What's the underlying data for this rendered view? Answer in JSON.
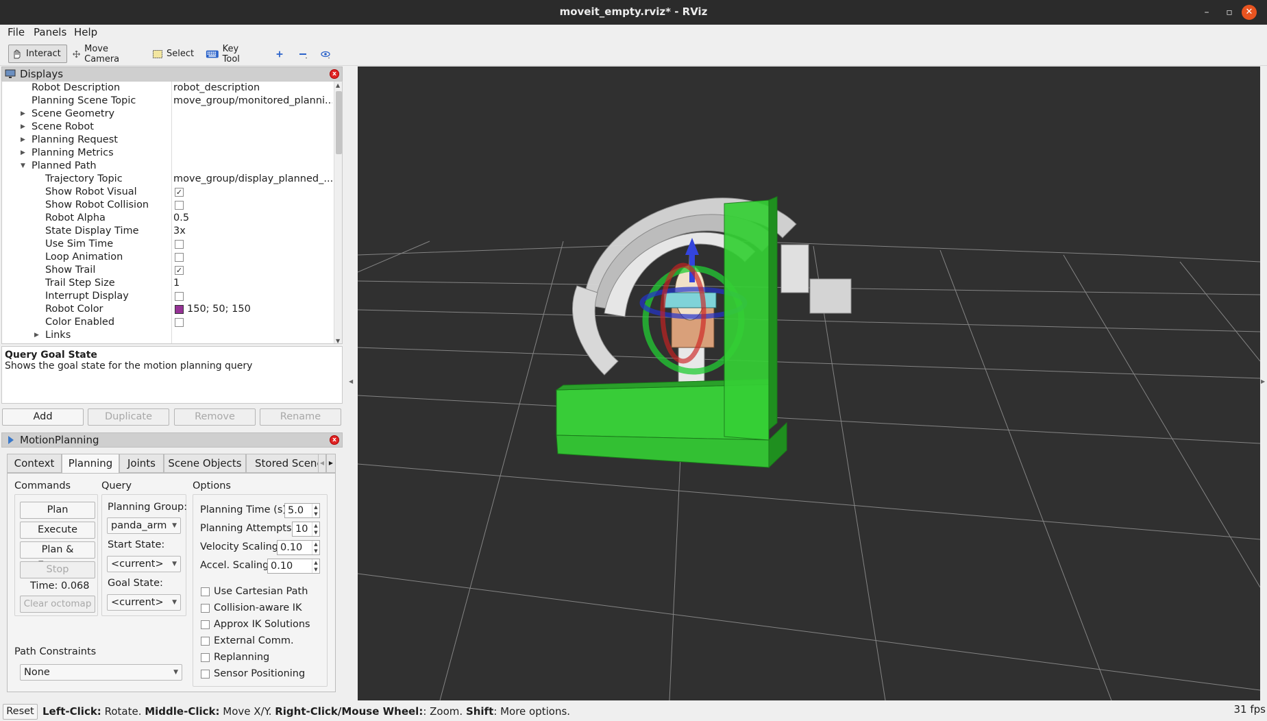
{
  "window": {
    "title": "moveit_empty.rviz* - RViz",
    "minimize_glyph": "–",
    "restore_glyph": "▫",
    "close_glyph": "✕"
  },
  "menu": [
    "File",
    "Panels",
    "Help"
  ],
  "toolbar": {
    "interact": "Interact",
    "move_camera": "Move Camera",
    "select": "Select",
    "key_tool": "Key Tool"
  },
  "displays": {
    "title": "Displays",
    "rows": [
      {
        "key": "Robot Description",
        "value": "robot_description"
      },
      {
        "key": "Planning Scene Topic",
        "value": "move_group/monitored_planni..."
      },
      {
        "key": "Scene Geometry",
        "value": ""
      },
      {
        "key": "Scene Robot",
        "value": ""
      },
      {
        "key": "Planning Request",
        "value": ""
      },
      {
        "key": "Planning Metrics",
        "value": ""
      },
      {
        "key": "Planned Path",
        "value": ""
      },
      {
        "key": "Trajectory Topic",
        "value": "move_group/display_planned_..."
      },
      {
        "key": "Show Robot Visual",
        "value": ""
      },
      {
        "key": "Show Robot Collision",
        "value": ""
      },
      {
        "key": "Robot Alpha",
        "value": "0.5"
      },
      {
        "key": "State Display Time",
        "value": "3x"
      },
      {
        "key": "Use Sim Time",
        "value": ""
      },
      {
        "key": "Loop Animation",
        "value": ""
      },
      {
        "key": "Show Trail",
        "value": ""
      },
      {
        "key": "Trail Step Size",
        "value": "1"
      },
      {
        "key": "Interrupt Display",
        "value": ""
      },
      {
        "key": "Robot Color",
        "value": "150; 50; 150"
      },
      {
        "key": "Color Enabled",
        "value": ""
      },
      {
        "key": "Links",
        "value": ""
      }
    ],
    "checks": {
      "show_robot_visual": true,
      "show_robot_collision": false,
      "use_sim_time": false,
      "loop_animation": false,
      "show_trail": true,
      "interrupt_display": false,
      "color_enabled": false
    },
    "robot_color_swatch": "#963296",
    "desc_title": "Query Goal State",
    "desc_text": "Shows the goal state for the motion planning query",
    "buttons": {
      "add": "Add",
      "duplicate": "Duplicate",
      "remove": "Remove",
      "rename": "Rename"
    }
  },
  "motion_planning": {
    "title": "MotionPlanning",
    "tabs": [
      "Context",
      "Planning",
      "Joints",
      "Scene Objects",
      "Stored Scene"
    ],
    "selected_tab": "Planning",
    "commands": {
      "heading": "Commands",
      "plan": "Plan",
      "execute": "Execute",
      "plan_execute": "Plan & Execute",
      "stop": "Stop",
      "time": "Time: 0.068",
      "clear_octomap": "Clear octomap"
    },
    "query": {
      "heading": "Query",
      "planning_group_label": "Planning Group:",
      "planning_group": "panda_arm",
      "start_state_label": "Start State:",
      "start_state": "<current>",
      "goal_state_label": "Goal State:",
      "goal_state": "<current>"
    },
    "options": {
      "heading": "Options",
      "planning_time_label": "Planning Time (s):",
      "planning_time": "5.0",
      "planning_attempts_label": "Planning Attempts:",
      "planning_attempts": "10",
      "velocity_scaling_label": "Velocity Scaling:",
      "velocity_scaling": "0.10",
      "accel_scaling_label": "Accel. Scaling:",
      "accel_scaling": "0.10",
      "checkboxes": [
        "Use Cartesian Path",
        "Collision-aware IK",
        "Approx IK Solutions",
        "External Comm.",
        "Replanning",
        "Sensor Positioning"
      ]
    },
    "path_constraints": {
      "label": "Path Constraints",
      "value": "None"
    }
  },
  "status": {
    "reset": "Reset",
    "parts": [
      {
        "bold": "Left-Click:",
        "text": " Rotate. "
      },
      {
        "bold": "Middle-Click:",
        "text": " Move X/Y. "
      },
      {
        "bold": "Right-Click/Mouse Wheel:",
        "text": ": Zoom. "
      },
      {
        "bold": "Shift",
        "text": ": More options."
      }
    ],
    "fps": "31 fps"
  },
  "scene": {
    "grid_color": "#a0a0a0",
    "background": "#303030",
    "obstacle_color": "#2fbf2f",
    "robot_color": "#dcdcdc"
  }
}
